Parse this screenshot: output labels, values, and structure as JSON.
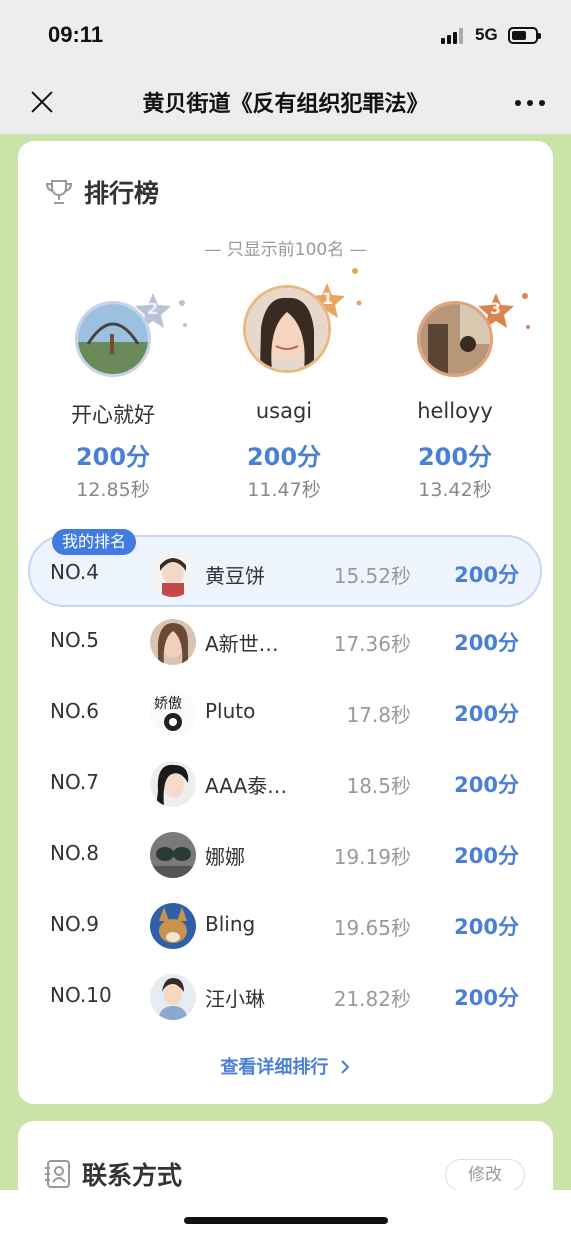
{
  "status": {
    "time": "09:11",
    "network": "5G"
  },
  "nav": {
    "title": "黄贝街道《反有组织犯罪法》"
  },
  "ranking": {
    "title": "排行榜",
    "subtitle": "— 只显示前100名 —",
    "podium": [
      {
        "rank": "2",
        "name": "开心就好",
        "score": "200分",
        "time": "12.85秒",
        "avatar": "photo-riverside"
      },
      {
        "rank": "1",
        "name": "usagi",
        "score": "200分",
        "time": "11.47秒",
        "avatar": "photo-girl"
      },
      {
        "rank": "3",
        "name": "helloyy",
        "score": "200分",
        "time": "13.42秒",
        "avatar": "photo-interior"
      }
    ],
    "my_tag": "我的排名",
    "my_rank": {
      "no": "NO.4",
      "name": "黄豆饼",
      "time": "15.52秒",
      "score": "200分"
    },
    "rows": [
      {
        "no": "NO.5",
        "name": "A新世…",
        "time": "17.36秒",
        "score": "200分"
      },
      {
        "no": "NO.6",
        "name": "Pluto",
        "time": "17.8秒",
        "score": "200分"
      },
      {
        "no": "NO.7",
        "name": "AAA泰…",
        "time": "18.5秒",
        "score": "200分"
      },
      {
        "no": "NO.8",
        "name": "娜娜",
        "time": "19.19秒",
        "score": "200分"
      },
      {
        "no": "NO.9",
        "name": "Bling",
        "time": "19.65秒",
        "score": "200分"
      },
      {
        "no": "NO.10",
        "name": "汪小琳",
        "time": "21.82秒",
        "score": "200分"
      }
    ],
    "detail_link": "查看详细排行",
    "colors": {
      "accent": "#4a7fd6",
      "gold": "#e9a660",
      "silver": "#b9c3d6",
      "bronze": "#d9834e"
    }
  },
  "contact": {
    "title": "联系方式",
    "edit_label": "修改"
  }
}
